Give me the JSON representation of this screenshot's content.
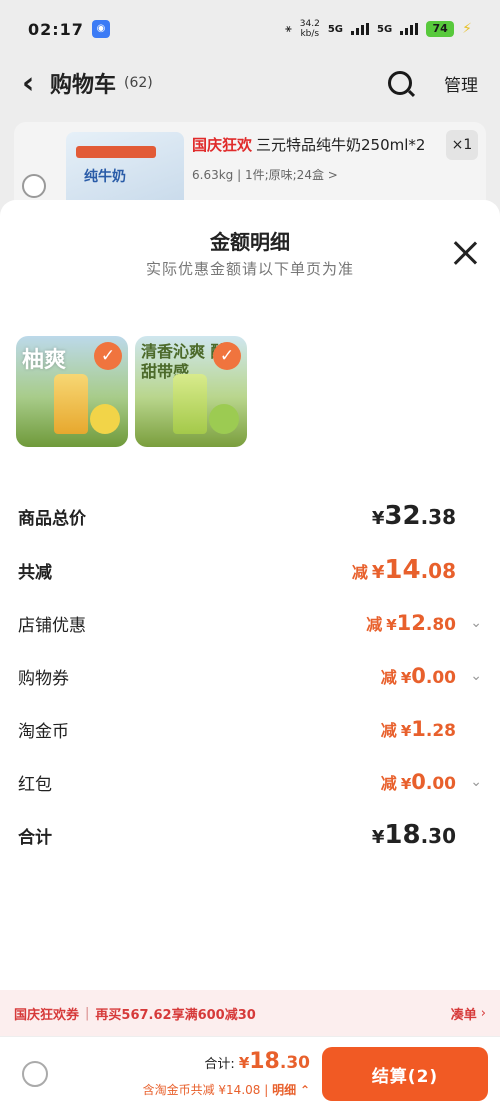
{
  "status_bar": {
    "time": "02:17",
    "net_speed_value": "34.2",
    "net_speed_unit": "kb/s",
    "signal_1": "5G",
    "signal_2": "5G",
    "battery": "74"
  },
  "cart_header": {
    "back_icon": "back-arrow-icon",
    "title": "购物车",
    "count": "(62)",
    "search_icon": "search-icon",
    "manage_label": "管理"
  },
  "cart_item": {
    "promo_tag": "国庆狂欢",
    "title": "三元特品纯牛奶250ml*2",
    "spec": "6.63kg | 1件;原味;24盒 >",
    "quantity": "×1",
    "thumb_brand": "纯牛奶"
  },
  "sheet": {
    "title": "金额明细",
    "subtitle": "实际优惠金额请以下单页为准",
    "close_icon": "close-icon",
    "thumbnails": [
      {
        "caption": "柚爽",
        "check_icon": "check-icon"
      },
      {
        "caption": "清香沁爽 酸甜带感",
        "check_icon": "check-icon"
      }
    ],
    "rows": [
      {
        "label": "商品总价",
        "prefix": "",
        "currency": "¥",
        "int": "32",
        "dec": ".38",
        "chevron": false
      },
      {
        "label": "共减",
        "prefix": "减",
        "currency": "¥",
        "int": "14",
        "dec": ".08",
        "chevron": false
      },
      {
        "label": "店铺优惠",
        "prefix": "减",
        "currency": "¥",
        "int": "12",
        "dec": ".80",
        "chevron": true
      },
      {
        "label": "购物券",
        "prefix": "减",
        "currency": "¥",
        "int": "0",
        "dec": ".00",
        "chevron": true
      },
      {
        "label": "淘金币",
        "prefix": "减",
        "currency": "¥",
        "int": "1",
        "dec": ".28",
        "chevron": false
      },
      {
        "label": "红包",
        "prefix": "减",
        "currency": "¥",
        "int": "0",
        "dec": ".00",
        "chevron": true
      },
      {
        "label": "合计",
        "prefix": "",
        "currency": "¥",
        "int": "18",
        "dec": ".30",
        "chevron": false
      }
    ]
  },
  "promo_bar": {
    "tag": "国庆狂欢券",
    "text": "再买567.62享满600减30",
    "link": "凑单",
    "arrow_icon": "chevron-right-icon"
  },
  "checkout": {
    "total_label": "合计:",
    "currency": "¥",
    "total_int": "18",
    "total_dec": ".30",
    "discount_text": "含淘金币共减 ¥14.08",
    "detail_label": "明细",
    "detail_icon": "chevron-up-icon",
    "button_label": "结算(2)"
  },
  "colors": {
    "accent": "#f15a24",
    "discount": "#e8602c",
    "promo_red": "#d63a3a",
    "promo_bg": "#fceeee"
  }
}
